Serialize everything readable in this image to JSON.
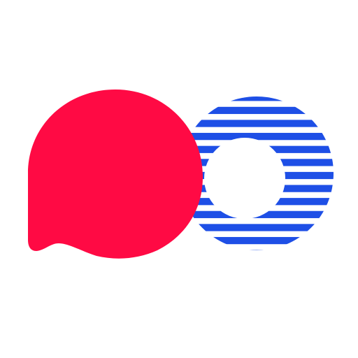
{
  "logo": {
    "name": "app-logo",
    "elements": [
      {
        "id": "speech-bubble",
        "icon": "speech-bubble-icon",
        "color": "#FF0A44"
      },
      {
        "id": "striped-ring",
        "icon": "striped-ring-icon",
        "color": "#1E4FE6",
        "stripe_count": 13
      }
    ],
    "background": "#FFFFFF"
  }
}
